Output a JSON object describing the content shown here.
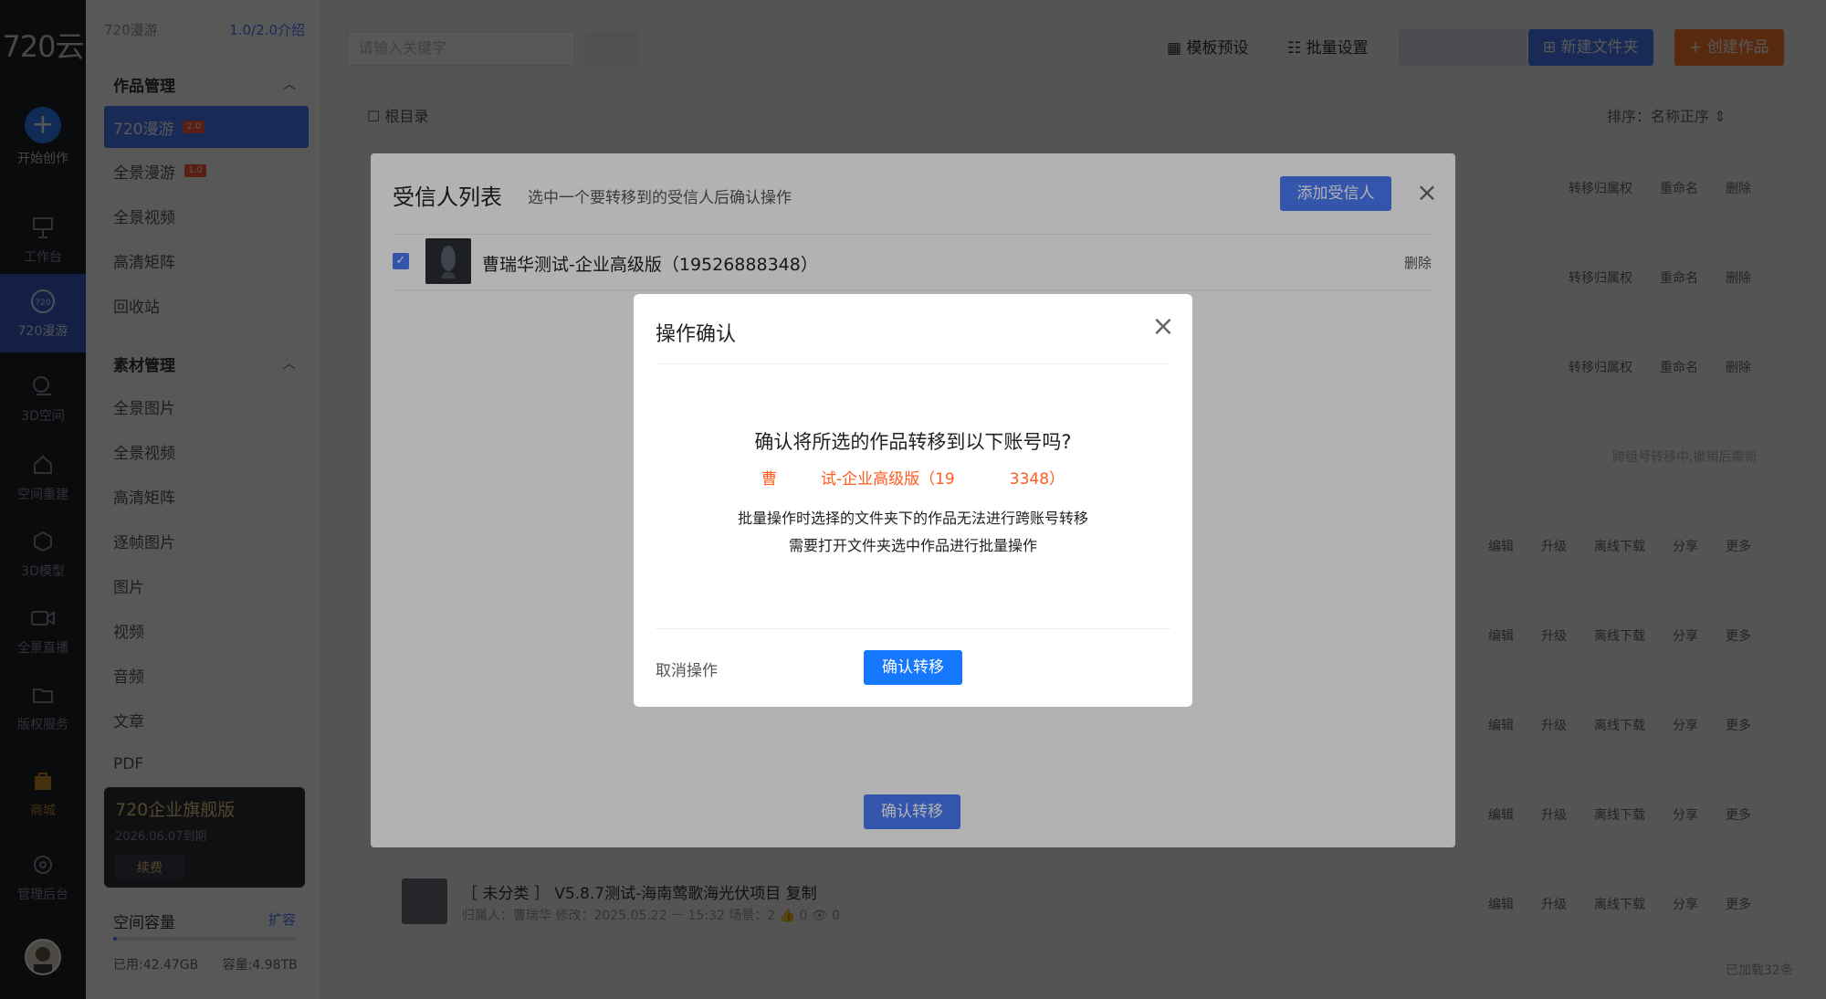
{
  "rail": {
    "logo": "720云",
    "items": [
      {
        "label": "开始创作",
        "icon": "plus-icon"
      },
      {
        "label": "工作台",
        "icon": "easel-icon"
      },
      {
        "label": "720漫游",
        "icon": "panorama-icon"
      },
      {
        "label": "3D空间",
        "icon": "space-icon"
      },
      {
        "label": "空间重建",
        "icon": "house-icon"
      },
      {
        "label": "3D模型",
        "icon": "cube-icon"
      },
      {
        "label": "全景直播",
        "icon": "video-camera-icon"
      },
      {
        "label": "版权服务",
        "icon": "folder-icon"
      },
      {
        "label": "商城",
        "icon": "shop-bag-icon"
      },
      {
        "label": "管理后台",
        "icon": "settings-icon"
      }
    ]
  },
  "sidebar": {
    "workspace": "720漫游",
    "quota": "1.0/2.0介绍",
    "works_group": "作品管理",
    "works_items": [
      {
        "label": "720漫游",
        "tag": "2.0"
      },
      {
        "label": "全景漫游",
        "tag": "1.0"
      },
      {
        "label": "全景视频",
        "tag": ""
      },
      {
        "label": "高清矩阵",
        "tag": ""
      },
      {
        "label": "回收站",
        "tag": ""
      }
    ],
    "materials_group": "素材管理",
    "materials_items": [
      "全景图片",
      "全景视频",
      "高清矩阵",
      "逐帧图片",
      "图片",
      "视频",
      "音频",
      "文章",
      "PDF"
    ],
    "vip": {
      "title": "720企业旗舰版",
      "date": "2026.06.07到期",
      "renew": "续费"
    },
    "capacity": {
      "label": "空间容量",
      "expand": "扩容",
      "used": "已用:42.47GB",
      "total": "容量:4.98TB",
      "used_fraction": 0.01
    }
  },
  "toolbar": {
    "search_placeholder": "请输入关键字",
    "template_preset": "模板预设",
    "batch_settings": "批量设置",
    "new_folder": "新建文件夹",
    "create_work": "创建作品"
  },
  "list": {
    "breadcrumb": "根目录",
    "sort": "排序：名称正序",
    "folder_actions": [
      "转移归属权",
      "重命名",
      "删除"
    ],
    "work_actions": [
      "编辑",
      "升级",
      "离线下载",
      "分享",
      "更多"
    ],
    "tip": "跨组号转移中,撤销后需新",
    "bottom_title": "［ 未分类 ］ V5.8.7测试-海南莺歌海光伏项目 复制",
    "bottom_meta": "归属人：曹瑞华   修改：2025.05.22 － 15:32   场景：2      👍 0      👁 0",
    "loaded": "已加载32条"
  },
  "recipient_panel": {
    "title": "受信人列表",
    "subtitle": "选中一个要转移到的受信人后确认操作",
    "add_button": "添加受信人",
    "recipient_name": "曹瑞华测试-企业高级版（19526888348）",
    "delete": "删除",
    "confirm_button": "确认转移"
  },
  "confirm_dialog": {
    "title": "操作确认",
    "question": "确认将所选的作品转移到以下账号吗?",
    "account_start": "曹",
    "account_mid": "试-企业高级版（19",
    "account_end": "3348）",
    "note1": "批量操作时选择的文件夹下的作品无法进行跨账号转移",
    "note2": "需要打开文件夹选中作品进行批量操作",
    "cancel": "取消操作",
    "ok": "确认转移"
  },
  "colors": {
    "primary": "#4a7bf7",
    "confirm_blue": "#1677ff",
    "accent_orange": "#ff5a1f",
    "rail_bg": "#1e2229"
  }
}
